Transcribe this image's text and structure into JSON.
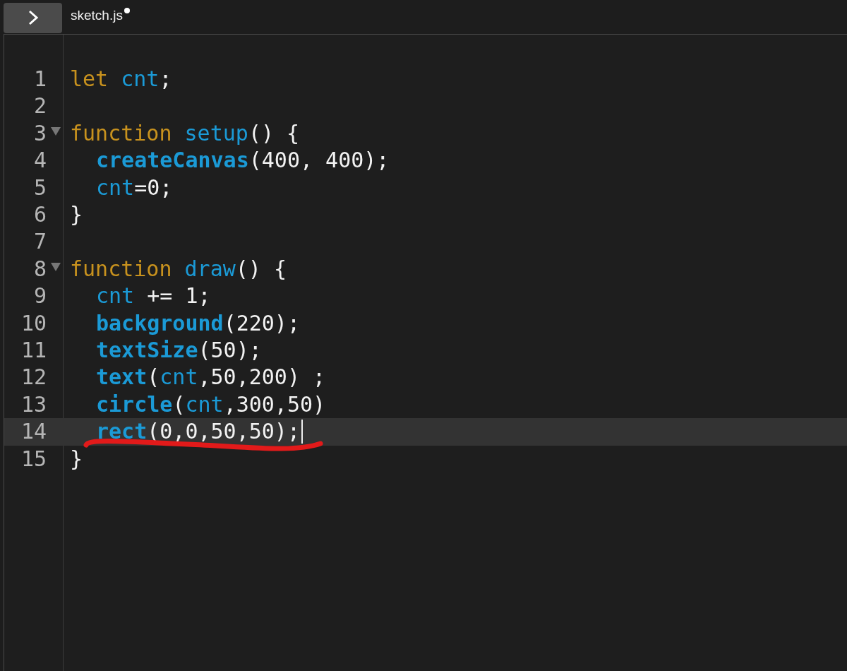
{
  "tab": {
    "name": "sketch.js",
    "unsaved": true
  },
  "editor": {
    "lines": [
      {
        "number": "1",
        "foldable": false,
        "active": false,
        "indented": false,
        "tokens": [
          {
            "text": "let ",
            "kind": "keyword"
          },
          {
            "text": "cnt",
            "kind": "variable"
          },
          {
            "text": ";",
            "kind": "plain"
          }
        ]
      },
      {
        "number": "2",
        "foldable": false,
        "active": false
      },
      {
        "number": "3",
        "foldable": true,
        "active": false,
        "indented": false,
        "tokens": [
          {
            "text": "function ",
            "kind": "keyword"
          },
          {
            "text": "setup",
            "kind": "variable"
          },
          {
            "text": "() {",
            "kind": "plain"
          }
        ]
      },
      {
        "number": "4",
        "foldable": false,
        "active": false,
        "indented": true,
        "tokens": [
          {
            "text": "createCanvas",
            "kind": "builtin"
          },
          {
            "text": "(400, 400);",
            "kind": "plain"
          }
        ]
      },
      {
        "number": "5",
        "foldable": false,
        "active": false,
        "indented": true,
        "tokens": [
          {
            "text": "cnt",
            "kind": "variable"
          },
          {
            "text": "=0;",
            "kind": "plain"
          }
        ]
      },
      {
        "number": "6",
        "foldable": false,
        "active": false,
        "indented": false,
        "tokens": [
          {
            "text": "}",
            "kind": "plain"
          }
        ]
      },
      {
        "number": "7",
        "foldable": false,
        "active": false
      },
      {
        "number": "8",
        "foldable": true,
        "active": false,
        "indented": false,
        "tokens": [
          {
            "text": "function ",
            "kind": "keyword"
          },
          {
            "text": "draw",
            "kind": "variable"
          },
          {
            "text": "() {",
            "kind": "plain"
          }
        ]
      },
      {
        "number": "9",
        "foldable": false,
        "active": false,
        "indented": true,
        "tokens": [
          {
            "text": "cnt",
            "kind": "variable"
          },
          {
            "text": " += 1;",
            "kind": "plain"
          }
        ]
      },
      {
        "number": "10",
        "foldable": false,
        "active": false,
        "indented": true,
        "tokens": [
          {
            "text": "background",
            "kind": "builtin"
          },
          {
            "text": "(220);",
            "kind": "plain"
          }
        ]
      },
      {
        "number": "11",
        "foldable": false,
        "active": false,
        "indented": true,
        "tokens": [
          {
            "text": "textSize",
            "kind": "builtin"
          },
          {
            "text": "(50);",
            "kind": "plain"
          }
        ]
      },
      {
        "number": "12",
        "foldable": false,
        "active": false,
        "indented": true,
        "tokens": [
          {
            "text": "text",
            "kind": "builtin"
          },
          {
            "text": "(",
            "kind": "plain"
          },
          {
            "text": "cnt",
            "kind": "variable"
          },
          {
            "text": ",50,200) ;",
            "kind": "plain"
          }
        ]
      },
      {
        "number": "13",
        "foldable": false,
        "active": false,
        "indented": true,
        "tokens": [
          {
            "text": "circle",
            "kind": "builtin"
          },
          {
            "text": "(",
            "kind": "plain"
          },
          {
            "text": "cnt",
            "kind": "variable"
          },
          {
            "text": ",300,50)",
            "kind": "plain"
          }
        ]
      },
      {
        "number": "14",
        "foldable": false,
        "active": true,
        "indented": true,
        "tokens": [
          {
            "text": "rect",
            "kind": "builtin"
          },
          {
            "text": "(0,0,50,50);",
            "kind": "plain"
          }
        ]
      },
      {
        "number": "15",
        "foldable": false,
        "active": false,
        "indented": false,
        "tokens": [
          {
            "text": "}",
            "kind": "plain"
          }
        ]
      }
    ]
  }
}
